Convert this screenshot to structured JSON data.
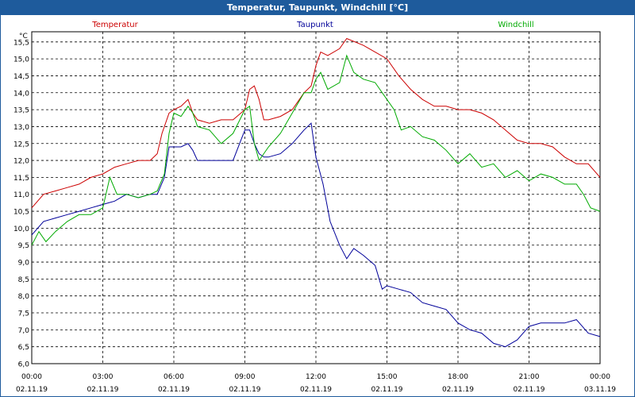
{
  "window": {
    "title": "Temperatur, Taupunkt, Windchill [°C]"
  },
  "chart_data": {
    "type": "line",
    "title": "Temperatur, Taupunkt, Windchill [°C]",
    "ylabel": "°C",
    "ylim": [
      6.0,
      15.8
    ],
    "grid": true,
    "legend_placement": "top",
    "y_ticks": [
      "6,0",
      "6,5",
      "7,0",
      "7,5",
      "8,0",
      "8,5",
      "9,0",
      "9,5",
      "10,0",
      "10,5",
      "11,0",
      "11,5",
      "12,0",
      "12,5",
      "13,0",
      "13,5",
      "14,0",
      "14,5",
      "15,0",
      "15,5"
    ],
    "x_ticks": [
      {
        "time": "00:00",
        "date": "02.11.19",
        "h": 0
      },
      {
        "time": "03:00",
        "date": "02.11.19",
        "h": 3
      },
      {
        "time": "06:00",
        "date": "02.11.19",
        "h": 6
      },
      {
        "time": "09:00",
        "date": "02.11.19",
        "h": 9
      },
      {
        "time": "12:00",
        "date": "02.11.19",
        "h": 12
      },
      {
        "time": "15:00",
        "date": "02.11.19",
        "h": 15
      },
      {
        "time": "18:00",
        "date": "02.11.19",
        "h": 18
      },
      {
        "time": "21:00",
        "date": "02.11.19",
        "h": 21
      },
      {
        "time": "00:00",
        "date": "03.11.19",
        "h": 24
      }
    ],
    "xlim": [
      0,
      24
    ],
    "series": [
      {
        "name": "Temperatur",
        "color": "#cc0000",
        "points": [
          [
            0,
            10.6
          ],
          [
            0.5,
            11.0
          ],
          [
            1,
            11.1
          ],
          [
            1.5,
            11.2
          ],
          [
            2,
            11.3
          ],
          [
            2.5,
            11.5
          ],
          [
            3,
            11.6
          ],
          [
            3.5,
            11.8
          ],
          [
            4,
            11.9
          ],
          [
            4.5,
            12.0
          ],
          [
            5,
            12.0
          ],
          [
            5.3,
            12.2
          ],
          [
            5.5,
            12.8
          ],
          [
            5.8,
            13.4
          ],
          [
            6,
            13.5
          ],
          [
            6.3,
            13.6
          ],
          [
            6.6,
            13.8
          ],
          [
            6.8,
            13.4
          ],
          [
            7,
            13.2
          ],
          [
            7.5,
            13.1
          ],
          [
            8,
            13.2
          ],
          [
            8.5,
            13.2
          ],
          [
            9,
            13.5
          ],
          [
            9.2,
            14.1
          ],
          [
            9.4,
            14.2
          ],
          [
            9.6,
            13.8
          ],
          [
            9.8,
            13.2
          ],
          [
            10,
            13.2
          ],
          [
            10.5,
            13.3
          ],
          [
            11,
            13.5
          ],
          [
            11.5,
            14.0
          ],
          [
            11.8,
            14.2
          ],
          [
            12,
            14.8
          ],
          [
            12.2,
            15.2
          ],
          [
            12.5,
            15.1
          ],
          [
            13,
            15.3
          ],
          [
            13.3,
            15.6
          ],
          [
            14,
            15.4
          ],
          [
            14.5,
            15.2
          ],
          [
            15,
            15.0
          ],
          [
            15.5,
            14.5
          ],
          [
            16,
            14.1
          ],
          [
            16.5,
            13.8
          ],
          [
            17,
            13.6
          ],
          [
            17.5,
            13.6
          ],
          [
            18,
            13.5
          ],
          [
            18.5,
            13.5
          ],
          [
            19,
            13.4
          ],
          [
            19.5,
            13.2
          ],
          [
            20,
            12.9
          ],
          [
            20.5,
            12.6
          ],
          [
            21,
            12.5
          ],
          [
            21.5,
            12.5
          ],
          [
            22,
            12.4
          ],
          [
            22.5,
            12.1
          ],
          [
            23,
            11.9
          ],
          [
            23.5,
            11.9
          ],
          [
            24,
            11.5
          ]
        ]
      },
      {
        "name": "Taupunkt",
        "color": "#000099",
        "points": [
          [
            0,
            9.8
          ],
          [
            0.5,
            10.2
          ],
          [
            1,
            10.3
          ],
          [
            1.5,
            10.4
          ],
          [
            2,
            10.5
          ],
          [
            2.5,
            10.6
          ],
          [
            3,
            10.7
          ],
          [
            3.5,
            10.8
          ],
          [
            4,
            11.0
          ],
          [
            4.5,
            10.9
          ],
          [
            5,
            11.0
          ],
          [
            5.3,
            11.0
          ],
          [
            5.6,
            11.5
          ],
          [
            5.8,
            12.4
          ],
          [
            6,
            12.4
          ],
          [
            6.3,
            12.4
          ],
          [
            6.6,
            12.5
          ],
          [
            6.8,
            12.3
          ],
          [
            7,
            12.0
          ],
          [
            7.5,
            12.0
          ],
          [
            8,
            12.0
          ],
          [
            8.5,
            12.0
          ],
          [
            9,
            12.9
          ],
          [
            9.2,
            12.9
          ],
          [
            9.4,
            12.5
          ],
          [
            9.6,
            12.2
          ],
          [
            9.8,
            12.1
          ],
          [
            10,
            12.1
          ],
          [
            10.5,
            12.2
          ],
          [
            11,
            12.5
          ],
          [
            11.5,
            12.9
          ],
          [
            11.8,
            13.1
          ],
          [
            12,
            12.1
          ],
          [
            12.3,
            11.3
          ],
          [
            12.6,
            10.2
          ],
          [
            13,
            9.5
          ],
          [
            13.3,
            9.1
          ],
          [
            13.6,
            9.4
          ],
          [
            14,
            9.2
          ],
          [
            14.5,
            8.9
          ],
          [
            14.8,
            8.2
          ],
          [
            15,
            8.3
          ],
          [
            15.5,
            8.2
          ],
          [
            16,
            8.1
          ],
          [
            16.5,
            7.8
          ],
          [
            17,
            7.7
          ],
          [
            17.5,
            7.6
          ],
          [
            18,
            7.2
          ],
          [
            18.5,
            7.0
          ],
          [
            19,
            6.9
          ],
          [
            19.5,
            6.6
          ],
          [
            20,
            6.5
          ],
          [
            20.5,
            6.7
          ],
          [
            21,
            7.1
          ],
          [
            21.5,
            7.2
          ],
          [
            22,
            7.2
          ],
          [
            22.5,
            7.2
          ],
          [
            23,
            7.3
          ],
          [
            23.5,
            6.9
          ],
          [
            24,
            6.8
          ]
        ]
      },
      {
        "name": "Windchill",
        "color": "#00aa00",
        "points": [
          [
            0,
            9.5
          ],
          [
            0.3,
            9.9
          ],
          [
            0.6,
            9.6
          ],
          [
            1,
            9.9
          ],
          [
            1.5,
            10.2
          ],
          [
            2,
            10.4
          ],
          [
            2.5,
            10.4
          ],
          [
            3,
            10.6
          ],
          [
            3.3,
            11.5
          ],
          [
            3.6,
            11.0
          ],
          [
            4,
            11.0
          ],
          [
            4.5,
            10.9
          ],
          [
            5,
            11.0
          ],
          [
            5.3,
            11.1
          ],
          [
            5.6,
            11.6
          ],
          [
            5.8,
            12.8
          ],
          [
            6,
            13.4
          ],
          [
            6.3,
            13.3
          ],
          [
            6.6,
            13.6
          ],
          [
            6.8,
            13.4
          ],
          [
            7,
            13.0
          ],
          [
            7.5,
            12.9
          ],
          [
            8,
            12.5
          ],
          [
            8.5,
            12.8
          ],
          [
            9,
            13.5
          ],
          [
            9.2,
            13.6
          ],
          [
            9.4,
            12.5
          ],
          [
            9.6,
            12.0
          ],
          [
            10,
            12.4
          ],
          [
            10.5,
            12.8
          ],
          [
            11,
            13.4
          ],
          [
            11.5,
            14.0
          ],
          [
            11.8,
            14.0
          ],
          [
            12,
            14.4
          ],
          [
            12.2,
            14.6
          ],
          [
            12.5,
            14.1
          ],
          [
            13,
            14.3
          ],
          [
            13.3,
            15.1
          ],
          [
            13.6,
            14.6
          ],
          [
            14,
            14.4
          ],
          [
            14.5,
            14.3
          ],
          [
            15,
            13.8
          ],
          [
            15.3,
            13.5
          ],
          [
            15.6,
            12.9
          ],
          [
            16,
            13.0
          ],
          [
            16.5,
            12.7
          ],
          [
            17,
            12.6
          ],
          [
            17.5,
            12.3
          ],
          [
            18,
            11.9
          ],
          [
            18.5,
            12.2
          ],
          [
            19,
            11.8
          ],
          [
            19.5,
            11.9
          ],
          [
            20,
            11.5
          ],
          [
            20.5,
            11.7
          ],
          [
            21,
            11.4
          ],
          [
            21.5,
            11.6
          ],
          [
            22,
            11.5
          ],
          [
            22.5,
            11.3
          ],
          [
            23,
            11.3
          ],
          [
            23.3,
            11.0
          ],
          [
            23.6,
            10.6
          ],
          [
            24,
            10.5
          ]
        ]
      }
    ]
  }
}
